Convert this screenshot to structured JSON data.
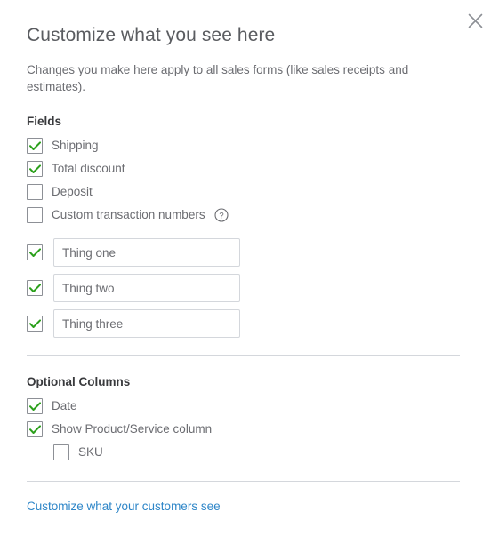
{
  "dialog": {
    "title": "Customize what you see here",
    "description": "Changes you make here apply to all sales forms (like sales receipts and estimates).",
    "close_icon": "close-icon"
  },
  "fields_section": {
    "heading": "Fields",
    "items": [
      {
        "label": "Shipping",
        "checked": true
      },
      {
        "label": "Total discount",
        "checked": true
      },
      {
        "label": "Deposit",
        "checked": false
      },
      {
        "label": "Custom transaction numbers",
        "checked": false,
        "help_icon": "help-circle-icon"
      }
    ],
    "custom_fields": [
      {
        "checked": true,
        "value": "Thing one",
        "placeholder": ""
      },
      {
        "checked": true,
        "value": "Thing two",
        "placeholder": ""
      },
      {
        "checked": true,
        "value": "Thing three",
        "placeholder": ""
      }
    ]
  },
  "optional_columns_section": {
    "heading": "Optional Columns",
    "items": [
      {
        "label": "Date",
        "checked": true,
        "indent": false
      },
      {
        "label": "Show Product/Service column",
        "checked": true,
        "indent": false
      },
      {
        "label": "SKU",
        "checked": false,
        "indent": true
      }
    ]
  },
  "footer": {
    "link_label": "Customize what your customers see"
  },
  "colors": {
    "check_green": "#2ca01c",
    "link_blue": "#2e86c8",
    "border_gray": "#8d9096",
    "input_border": "#d4d7dc",
    "text_gray": "#6b6c71",
    "heading_dark": "#393a3d"
  }
}
